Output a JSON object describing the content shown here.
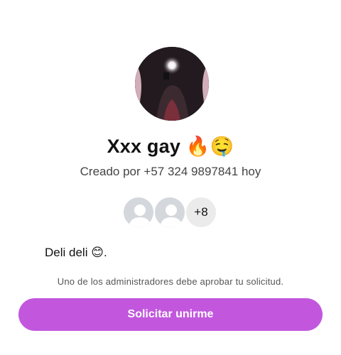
{
  "group": {
    "name": "Xxx gay",
    "name_emojis": "🔥🤤",
    "creator_line": "Creado por +57 324 9897841 hoy",
    "description": "Deli deli",
    "description_emoji": "😊",
    "description_end": "."
  },
  "members": {
    "extra_count": "+8"
  },
  "join": {
    "note": "Uno de los administradores debe aprobar tu solicitud.",
    "button_label": "Solicitar unirme"
  },
  "colors": {
    "accent": "#c257de",
    "placeholder_avatar": "#d4d7dc"
  }
}
